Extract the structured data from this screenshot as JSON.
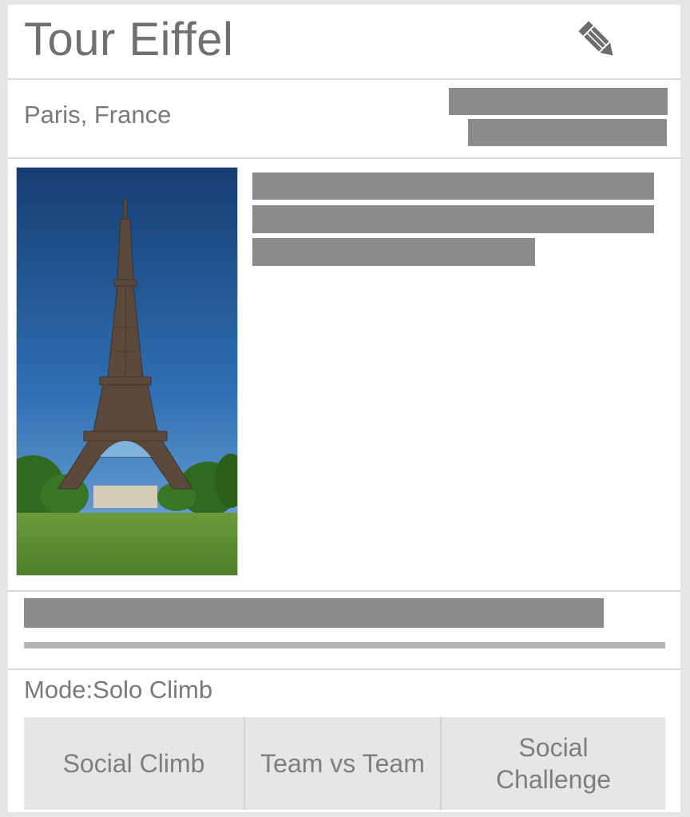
{
  "header": {
    "title": "Tour Eiffel",
    "edit_icon": "pencil-icon"
  },
  "location": "Paris, France",
  "mode": {
    "label": "Mode:",
    "value": "Solo Climb"
  },
  "mode_buttons": [
    {
      "label": "Social Climb"
    },
    {
      "label": "Team vs Team"
    },
    {
      "label": "Social Challenge"
    }
  ],
  "colors": {
    "background": "#e6e6e6",
    "card": "#ffffff",
    "text": "#707070",
    "redaction": "#8c8c8c",
    "button": "#e6e6e6"
  }
}
